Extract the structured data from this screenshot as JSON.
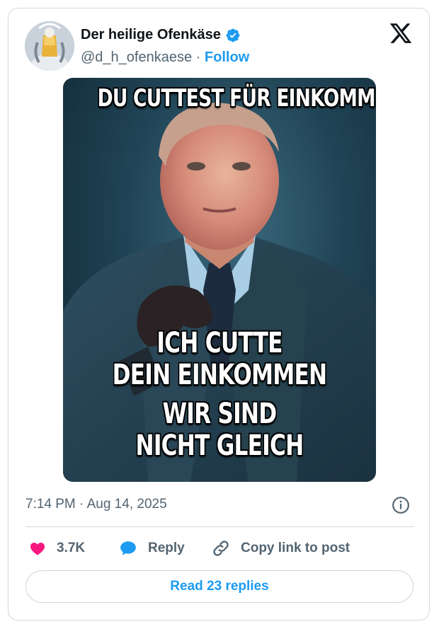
{
  "author": {
    "display_name": "Der heilige Ofenkäse",
    "handle": "@d_h_ofenkaese",
    "separator": "·",
    "follow_label": "Follow",
    "verified": true
  },
  "media": {
    "top_text": "DU CUTTEST FÜR EINKOMMEN",
    "bottom_lines": [
      "ICH CUTTE",
      "DEIN EINKOMMEN",
      "WIR SIND",
      "NICHT GLEICH"
    ]
  },
  "timestamp": "7:14 PM · Aug 14, 2025",
  "actions": {
    "likes_count": "3.7K",
    "reply_label": "Reply",
    "copy_link_label": "Copy link to post"
  },
  "read_replies_label": "Read 23 replies",
  "icons": {
    "brand": "x-logo-icon",
    "verified": "verified-badge-icon",
    "info": "info-icon",
    "like": "heart-icon",
    "reply": "reply-bubble-icon",
    "copy": "link-icon"
  },
  "colors": {
    "accent": "#1d9bf0",
    "heart": "#f91880",
    "text_secondary": "#536471",
    "border": "#cfd9de"
  }
}
